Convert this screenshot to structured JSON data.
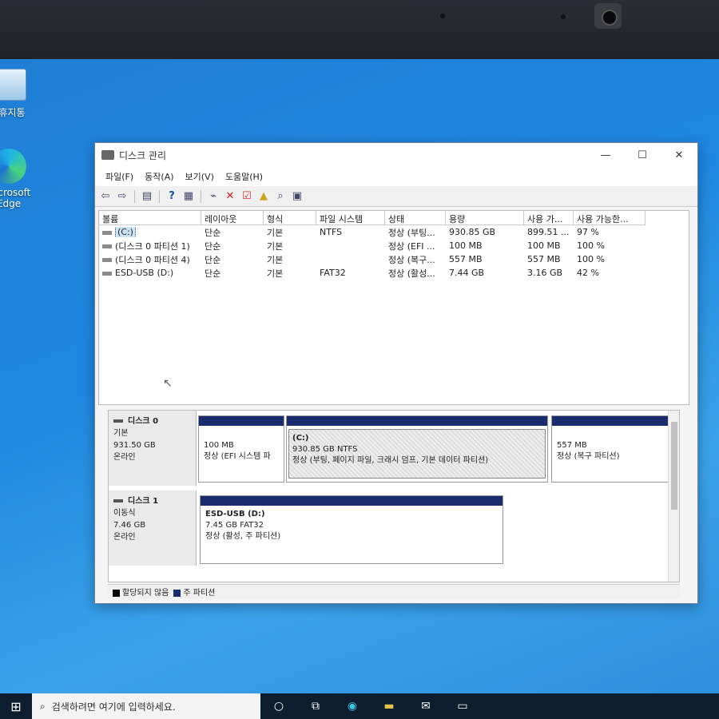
{
  "desktop": {
    "recycle_label": "휴지통",
    "edge_label_1": "Microsoft",
    "edge_label_2": "Edge"
  },
  "window": {
    "title": "디스크 관리",
    "minimize": "—",
    "maximize": "☐",
    "close": "✕"
  },
  "menu": [
    "파일(F)",
    "동작(A)",
    "보기(V)",
    "도움말(H)"
  ],
  "volumes": {
    "headers": [
      "볼륨",
      "레이아웃",
      "형식",
      "파일 시스템",
      "상태",
      "용량",
      "사용 가...",
      "사용 가능한..."
    ],
    "rows": [
      [
        "(C:)",
        "단순",
        "기본",
        "NTFS",
        "정상 (부팅...",
        "930.85 GB",
        "899.51 ...",
        "97 %"
      ],
      [
        "(디스크 0 파티션 1)",
        "단순",
        "기본",
        "",
        "정상 (EFI ...",
        "100 MB",
        "100 MB",
        "100 %"
      ],
      [
        "(디스크 0 파티션 4)",
        "단순",
        "기본",
        "",
        "정상 (복구...",
        "557 MB",
        "557 MB",
        "100 %"
      ],
      [
        "ESD-USB (D:)",
        "단순",
        "기본",
        "FAT32",
        "정상 (활성...",
        "7.44 GB",
        "3.16 GB",
        "42 %"
      ]
    ]
  },
  "disks": [
    {
      "name": "디스크 0",
      "type": "기본",
      "size": "931.50 GB",
      "status": "온라인",
      "partitions": [
        {
          "label": "",
          "size": "100 MB",
          "status": "정상 (EFI 시스템 파"
        },
        {
          "label": "(C:)",
          "size": "930.85 GB NTFS",
          "status": "정상 (부팅, 페이지 파일, 크래시 덤프, 기본 데이터 파티션)"
        },
        {
          "label": "",
          "size": "557 MB",
          "status": "정상 (복구 파티션)"
        }
      ]
    },
    {
      "name": "디스크 1",
      "type": "이동식",
      "size": "7.46 GB",
      "status": "온라인",
      "partitions": [
        {
          "label": "ESD-USB (D:)",
          "size": "7.45 GB FAT32",
          "status": "정상 (활성, 주 파티션)"
        }
      ]
    }
  ],
  "legend": {
    "unallocated": "할당되지 않음",
    "primary": "주 파티션",
    "unallocated_color": "#000000",
    "primary_color": "#1a2c6e"
  },
  "taskbar": {
    "search_placeholder": "검색하려면 여기에 입력하세요."
  }
}
